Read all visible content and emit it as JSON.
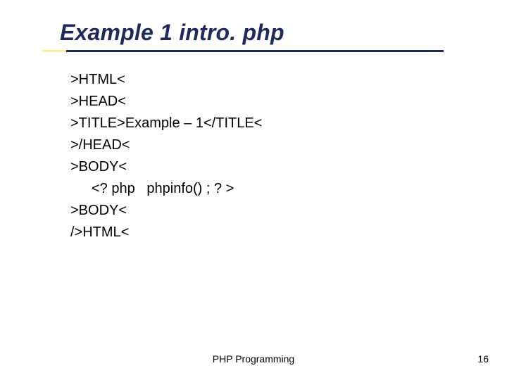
{
  "title": "Example  1 intro. php",
  "code": {
    "l1": ">HTML<",
    "l2": ">HEAD<",
    "l3": ">TITLE>Example – 1</TITLE<",
    "l4": ">/HEAD<",
    "l5": ">BODY<",
    "l6": "<? php   phpinfo() ; ? >",
    "l7": ">BODY<",
    "l8": "/>HTML<"
  },
  "footer": "PHP Programming",
  "page_number": "16"
}
